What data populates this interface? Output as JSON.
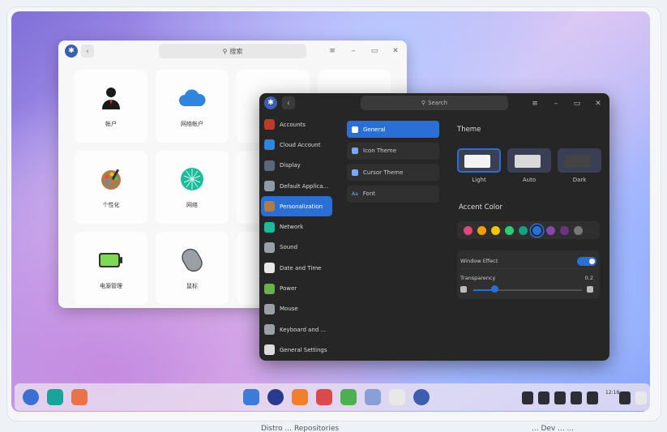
{
  "light_window": {
    "search_placeholder": "搜索",
    "window_controls": [
      "≡",
      "–",
      "▭",
      "✕"
    ],
    "tiles": [
      {
        "label": "帐户",
        "icon": "account-icon"
      },
      {
        "label": "网络帐户",
        "icon": "cloud-icon"
      },
      {
        "label": "",
        "icon": ""
      },
      {
        "label": "",
        "icon": ""
      },
      {
        "label": "个性化",
        "icon": "palette-icon"
      },
      {
        "label": "网络",
        "icon": "network-icon"
      },
      {
        "label": "",
        "icon": ""
      },
      {
        "label": "",
        "icon": ""
      },
      {
        "label": "电源管理",
        "icon": "battery-icon"
      },
      {
        "label": "鼠标",
        "icon": "mouse-icon"
      },
      {
        "label": "",
        "icon": ""
      },
      {
        "label": "",
        "icon": ""
      }
    ]
  },
  "dark_window": {
    "search_placeholder": "Search",
    "window_controls": [
      "≡",
      "–",
      "▭",
      "✕"
    ],
    "sidebar": [
      {
        "label": "Accounts",
        "icon": "account-icon",
        "color": "#c0392b"
      },
      {
        "label": "Cloud Account",
        "icon": "cloud-icon",
        "color": "#2e86de"
      },
      {
        "label": "Display",
        "icon": "display-icon",
        "color": "#5a6a7a"
      },
      {
        "label": "Default Applica...",
        "icon": "default-apps-icon",
        "color": "#8e9aa8"
      },
      {
        "label": "Personalization",
        "icon": "palette-icon",
        "color": "#b07b4a"
      },
      {
        "label": "Network",
        "icon": "network-icon",
        "color": "#1abc9c"
      },
      {
        "label": "Sound",
        "icon": "sound-icon",
        "color": "#9aa0a6"
      },
      {
        "label": "Date and Time",
        "icon": "clock-icon",
        "color": "#e8e8e8"
      },
      {
        "label": "Power",
        "icon": "battery-icon",
        "color": "#6ab04c"
      },
      {
        "label": "Mouse",
        "icon": "mouse-icon",
        "color": "#9aa0a6"
      },
      {
        "label": "Keyboard and ...",
        "icon": "keyboard-icon",
        "color": "#9aa0a6"
      },
      {
        "label": "General Settings",
        "icon": "gear-icon",
        "color": "#dcdcdc"
      }
    ],
    "active_sidebar_index": 4,
    "subnav": [
      {
        "label": "General",
        "icon": "general-icon"
      },
      {
        "label": "Icon Theme",
        "icon": "icon-theme-icon"
      },
      {
        "label": "Cursor Theme",
        "icon": "cursor-theme-icon"
      },
      {
        "label": "Font",
        "icon": "font-icon",
        "glyph": "Aa"
      }
    ],
    "active_subnav_index": 0,
    "theme": {
      "heading": "Theme",
      "options": [
        {
          "label": "Light",
          "selected": true,
          "inner": "#f3f3f3"
        },
        {
          "label": "Auto",
          "selected": false,
          "inner": "#d9d9d9"
        },
        {
          "label": "Dark",
          "selected": false,
          "inner": "#444"
        }
      ]
    },
    "accent": {
      "heading": "Accent Color",
      "colors": [
        "#e0457b",
        "#f39c12",
        "#f1c40f",
        "#2ecc71",
        "#16a085",
        "#2a6fd6",
        "#8e44ad",
        "#6c3483",
        "#777777"
      ],
      "selected_index": 5
    },
    "window_effect_label": "Window Effect",
    "window_effect_on": true,
    "transparency_label": "Transparency",
    "transparency_value": "0.2",
    "transparency_fraction": 0.2
  },
  "taskbar": {
    "clock": "12:18"
  },
  "caption": {
    "left": "Distro ... Repositories",
    "right": "... Dev ... ..."
  }
}
